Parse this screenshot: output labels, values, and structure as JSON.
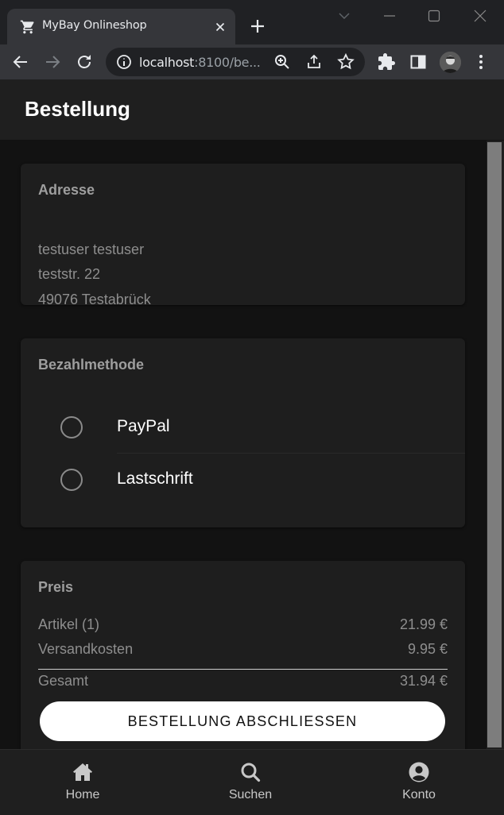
{
  "browser": {
    "tab_title": "MyBay Onlineshop",
    "url_host": "localhost",
    "url_rest": ":8100/be..."
  },
  "header": {
    "title": "Bestellung"
  },
  "address_card": {
    "title": "Adresse",
    "name": "testuser testuser",
    "street": "teststr. 22",
    "city": "49076 Testabrück"
  },
  "payment_card": {
    "title": "Bezahlmethode",
    "options": [
      {
        "label": "PayPal",
        "selected": false
      },
      {
        "label": "Lastschrift",
        "selected": false
      }
    ]
  },
  "price_card": {
    "title": "Preis",
    "rows": [
      {
        "label": "Artikel (1)",
        "value": "21.99 €"
      },
      {
        "label": "Versandkosten",
        "value": "9.95 €"
      }
    ],
    "total_label": "Gesamt",
    "total_value": "31.94 €",
    "checkout_label": "BESTELLUNG ABSCHLIESSEN"
  },
  "tabbar": {
    "items": [
      {
        "label": "Home",
        "icon": "home-icon"
      },
      {
        "label": "Suchen",
        "icon": "search-icon"
      },
      {
        "label": "Konto",
        "icon": "account-icon"
      }
    ]
  },
  "colors": {
    "background": "#121212",
    "card": "#1e1e1e",
    "button": "#ffffff",
    "header": "#1f1f1f"
  }
}
